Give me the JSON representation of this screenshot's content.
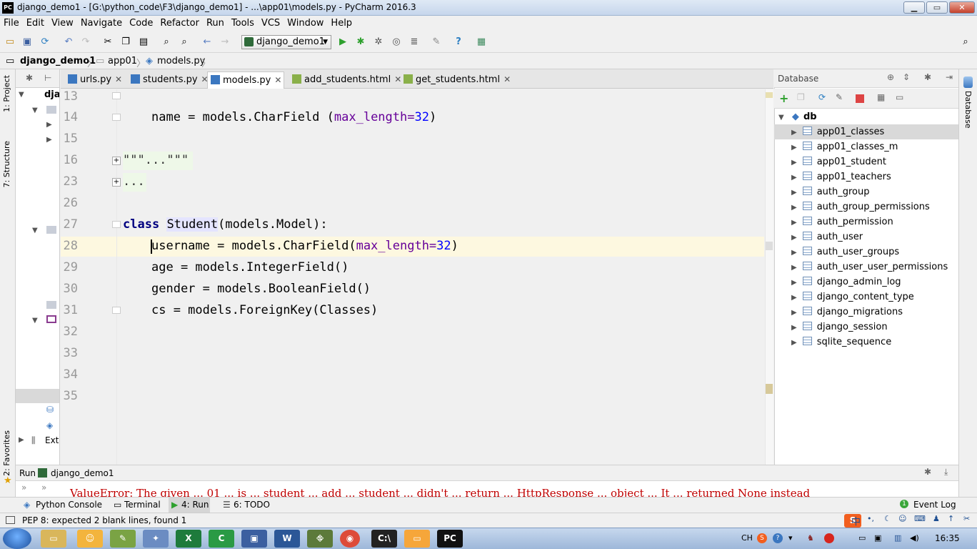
{
  "window": {
    "title": "django_demo1 - [G:\\python_code\\F3\\django_demo1] - ...\\app01\\models.py - PyCharm 2016.3",
    "app_icon": "PC",
    "min_label": "▁",
    "max_label": "▭",
    "close_label": "✕"
  },
  "menu": [
    "File",
    "Edit",
    "View",
    "Navigate",
    "Code",
    "Refactor",
    "Run",
    "Tools",
    "VCS",
    "Window",
    "Help"
  ],
  "toolbar": {
    "run_config": "django_demo1"
  },
  "breadcrumb": [
    "django_demo1",
    "app01",
    "models.py"
  ],
  "left_stripe": {
    "project": "1: Project",
    "structure": "7: Structure",
    "favorites": "2: Favorites"
  },
  "project_panel": {
    "root": "dja",
    "external": "Exte"
  },
  "tabs": [
    {
      "label": "urls.py",
      "active": false
    },
    {
      "label": "students.py",
      "active": false
    },
    {
      "label": "models.py",
      "active": true
    },
    {
      "label": "add_students.html",
      "active": false
    },
    {
      "label": "get_students.html",
      "active": false
    }
  ],
  "editor": {
    "lines": [
      {
        "num": "13",
        "text": "\"\"\""
      },
      {
        "num": "14",
        "text": "name = models.CharField (max_length=32)"
      },
      {
        "num": "15",
        "text": ""
      },
      {
        "num": "16",
        "text": "\"\"\"...\"\"\""
      },
      {
        "num": "23",
        "text": "..."
      },
      {
        "num": "26",
        "text": ""
      },
      {
        "num": "27",
        "text": "class Student(models.Model):"
      },
      {
        "num": "28",
        "text": "username = models.CharField(max_length=32)"
      },
      {
        "num": "29",
        "text": "age = models.IntegerField()"
      },
      {
        "num": "30",
        "text": "gender = models.BooleanField()"
      },
      {
        "num": "31",
        "text": "cs = models.ForeignKey(Classes)"
      },
      {
        "num": "32",
        "text": ""
      },
      {
        "num": "33",
        "text": ""
      },
      {
        "num": "34",
        "text": ""
      },
      {
        "num": "35",
        "text": ""
      }
    ],
    "tokens": {
      "l14_a": "name = models.CharField ",
      "l14_p": "(",
      "l14_b": "max_length=",
      "l14_n": "32",
      "l14_c": ")",
      "l27_kw": "class",
      "l27_cls": "Student",
      "l27_rest": "(models.Model):",
      "l28_a": "username = models.CharField(",
      "l28_b": "max_length=",
      "l28_n": "32",
      "l28_c": ")",
      "l29": "age = models.IntegerField()",
      "l30": "gender = models.BooleanField()",
      "l31": "cs = models.ForeignKey(Classes)"
    }
  },
  "database": {
    "title": "Database",
    "root": "db",
    "tables": [
      "app01_classes",
      "app01_classes_m",
      "app01_student",
      "app01_teachers",
      "auth_group",
      "auth_group_permissions",
      "auth_permission",
      "auth_user",
      "auth_user_groups",
      "auth_user_user_permissions",
      "django_admin_log",
      "django_content_type",
      "django_migrations",
      "django_session",
      "sqlite_sequence"
    ],
    "selected_index": 0,
    "right_stripe": "Database"
  },
  "run_panel": {
    "label": "Run",
    "config": "django_demo1",
    "output": "ValueError: The given ... 01 ... is ... student ... add ... student ... didn't ... return ... HttpResponse ... object ... It ... returned None instead"
  },
  "bottom_tabs": [
    "Python Console",
    "Terminal",
    "4: Run",
    "6: TODO"
  ],
  "event_log": "Event Log",
  "status": "PEP 8: expected 2 blank lines, found 1",
  "taskbar": {
    "time": "16:35",
    "lang": "CH"
  },
  "colors": {
    "keyword": "#000080",
    "param": "#660099",
    "number": "#0000ff",
    "current_line": "#fdf8e0",
    "selection": "#d9d9d9"
  }
}
